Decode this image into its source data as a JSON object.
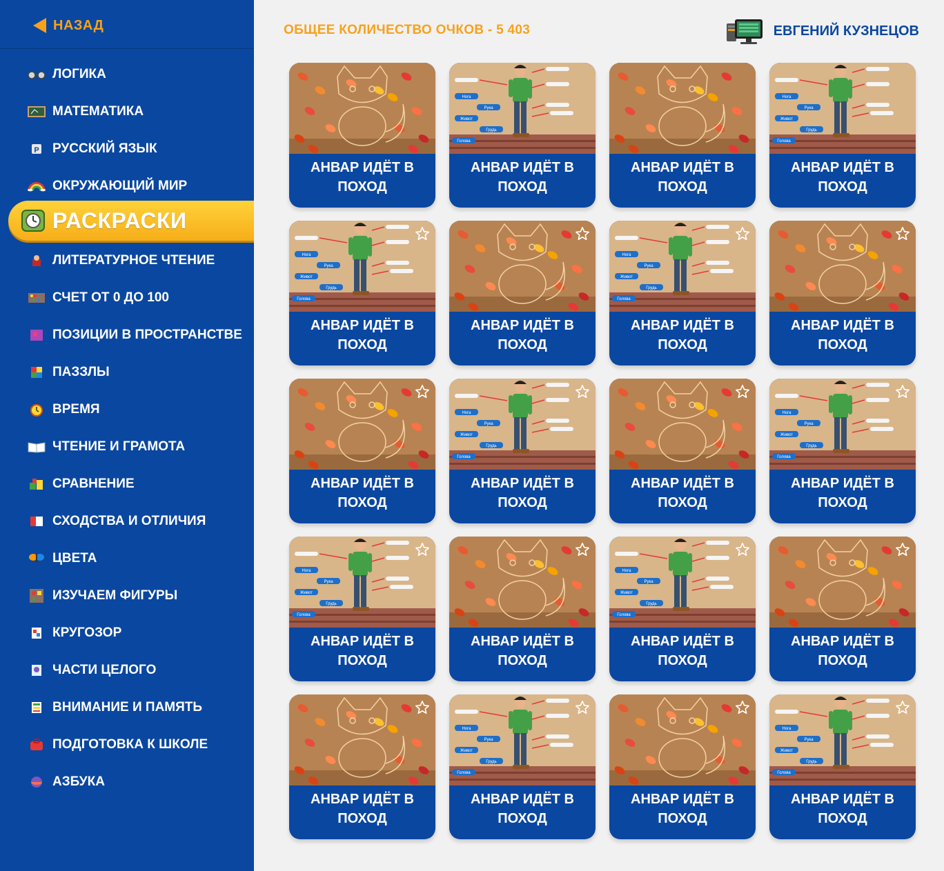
{
  "back": {
    "label": "НАЗАД"
  },
  "header": {
    "score": "ОБЩЕЕ КОЛИЧЕСТВО ОЧКОВ - 5 403",
    "user_name": "ЕВГЕНИЙ КУЗНЕЦОВ"
  },
  "sidebar": {
    "items": [
      {
        "label": "ЛОГИКА",
        "icon": "glasses-icon"
      },
      {
        "label": "МАТЕМАТИКА",
        "icon": "chalkboard-icon"
      },
      {
        "label": "РУССКИЙ ЯЗЫК",
        "icon": "letter-icon"
      },
      {
        "label": "ОКРУЖАЮЩИЙ МИР",
        "icon": "rainbow-icon"
      },
      {
        "label": "РАСКРАСКИ",
        "icon": "clock-icon",
        "active": true
      },
      {
        "label": "ЛИТЕРАТУРНОЕ ЧТЕНИЕ",
        "icon": "book-character-icon"
      },
      {
        "label": "СЧЕТ ОТ 0 ДО 100",
        "icon": "abacus-icon"
      },
      {
        "label": "ПОЗИЦИИ В ПРОСТРАНСТВЕ",
        "icon": "cube-icon"
      },
      {
        "label": "ПАЗЗЛЫ",
        "icon": "rubik-cube-icon"
      },
      {
        "label": "ВРЕМЯ",
        "icon": "alarm-clock-icon"
      },
      {
        "label": "ЧТЕНИЕ И ГРАМОТА",
        "icon": "open-book-icon"
      },
      {
        "label": "СРАВНЕНИЕ",
        "icon": "blocks-icon"
      },
      {
        "label": "СХОДСТВА И ОТЛИЧИЯ",
        "icon": "cards-icon"
      },
      {
        "label": "ЦВЕТА",
        "icon": "butterfly-icon"
      },
      {
        "label": "ИЗУЧАЕМ ФИГУРЫ",
        "icon": "shapes-board-icon"
      },
      {
        "label": "КРУГОЗОР",
        "icon": "quiz-card-icon"
      },
      {
        "label": "ЧАСТИ ЦЕЛОГО",
        "icon": "puzzle-card-icon"
      },
      {
        "label": "ВНИМАНИЕ И ПАМЯТЬ",
        "icon": "memory-grid-icon"
      },
      {
        "label": "ПОДГОТОВКА К ШКОЛЕ",
        "icon": "school-bag-icon"
      },
      {
        "label": "АЗБУКА",
        "icon": "alphabet-ball-icon"
      }
    ]
  },
  "cards": [
    {
      "title": "АНВАР ИДЁТ В ПОХОД",
      "image": "fox-coloring",
      "star": false
    },
    {
      "title": "АНВАР ИДЁТ В ПОХОД",
      "image": "boy-body-parts",
      "star": false,
      "labels": [
        "Нога",
        "Рука",
        "Живот",
        "Грудь",
        "Голова"
      ]
    },
    {
      "title": "АНВАР ИДЁТ В ПОХОД",
      "image": "fox-coloring",
      "star": false
    },
    {
      "title": "АНВАР ИДЁТ В ПОХОД",
      "image": "boy-body-parts",
      "star": false,
      "labels": [
        "Нога",
        "Рука",
        "Живот",
        "Грудь",
        "Голова"
      ]
    },
    {
      "title": "АНВАР ИДЁТ В ПОХОД",
      "image": "boy-body-parts",
      "star": true,
      "labels": [
        "Нога",
        "Рука",
        "Живот",
        "Грудь",
        "Голова"
      ]
    },
    {
      "title": "АНВАР ИДЁТ В ПОХОД",
      "image": "fox-coloring",
      "star": true
    },
    {
      "title": "АНВАР ИДЁТ В ПОХОД",
      "image": "boy-body-parts",
      "star": true,
      "labels": [
        "Нога",
        "Рука",
        "Живот",
        "Грудь",
        "Голова"
      ]
    },
    {
      "title": "АНВАР ИДЁТ В ПОХОД",
      "image": "fox-coloring",
      "star": true
    },
    {
      "title": "АНВАР ИДЁТ В ПОХОД",
      "image": "fox-coloring",
      "star": true
    },
    {
      "title": "АНВАР ИДЁТ В ПОХОД",
      "image": "boy-body-parts",
      "star": true,
      "labels": [
        "Нога",
        "Рука",
        "Живот",
        "Грудь",
        "Голова"
      ]
    },
    {
      "title": "АНВАР ИДЁТ В ПОХОД",
      "image": "fox-coloring",
      "star": true
    },
    {
      "title": "АНВАР ИДЁТ В ПОХОД",
      "image": "boy-body-parts",
      "star": true,
      "labels": [
        "Нога",
        "Рука",
        "Живот",
        "Грудь",
        "Голова"
      ]
    },
    {
      "title": "АНВАР ИДЁТ В ПОХОД",
      "image": "boy-body-parts",
      "star": true,
      "labels": [
        "Нога",
        "Рука",
        "Живот",
        "Грудь",
        "Голова"
      ]
    },
    {
      "title": "АНВАР ИДЁТ В ПОХОД",
      "image": "fox-coloring",
      "star": true
    },
    {
      "title": "АНВАР ИДЁТ В ПОХОД",
      "image": "boy-body-parts",
      "star": true,
      "labels": [
        "Нога",
        "Рука",
        "Живот",
        "Грудь",
        "Голова"
      ]
    },
    {
      "title": "АНВАР ИДЁТ В ПОХОД",
      "image": "fox-coloring",
      "star": true
    },
    {
      "title": "АНВАР ИДЁТ В ПОХОД",
      "image": "fox-coloring",
      "star": true
    },
    {
      "title": "АНВАР ИДЁТ В ПОХОД",
      "image": "boy-body-parts",
      "star": true,
      "labels": [
        "Нога",
        "Рука",
        "Живот",
        "Грудь",
        "Голова"
      ]
    },
    {
      "title": "АНВАР ИДЁТ В ПОХОД",
      "image": "fox-coloring",
      "star": true
    },
    {
      "title": "АНВАР ИДЁТ В ПОХОД",
      "image": "boy-body-parts",
      "star": true,
      "labels": [
        "Нога",
        "Рука",
        "Живот",
        "Грудь",
        "Голова"
      ]
    }
  ],
  "colors": {
    "sidebar": "#0a47a0",
    "accent": "#f7a21b",
    "card": "#0a47a0",
    "background": "#f1f1f1"
  }
}
